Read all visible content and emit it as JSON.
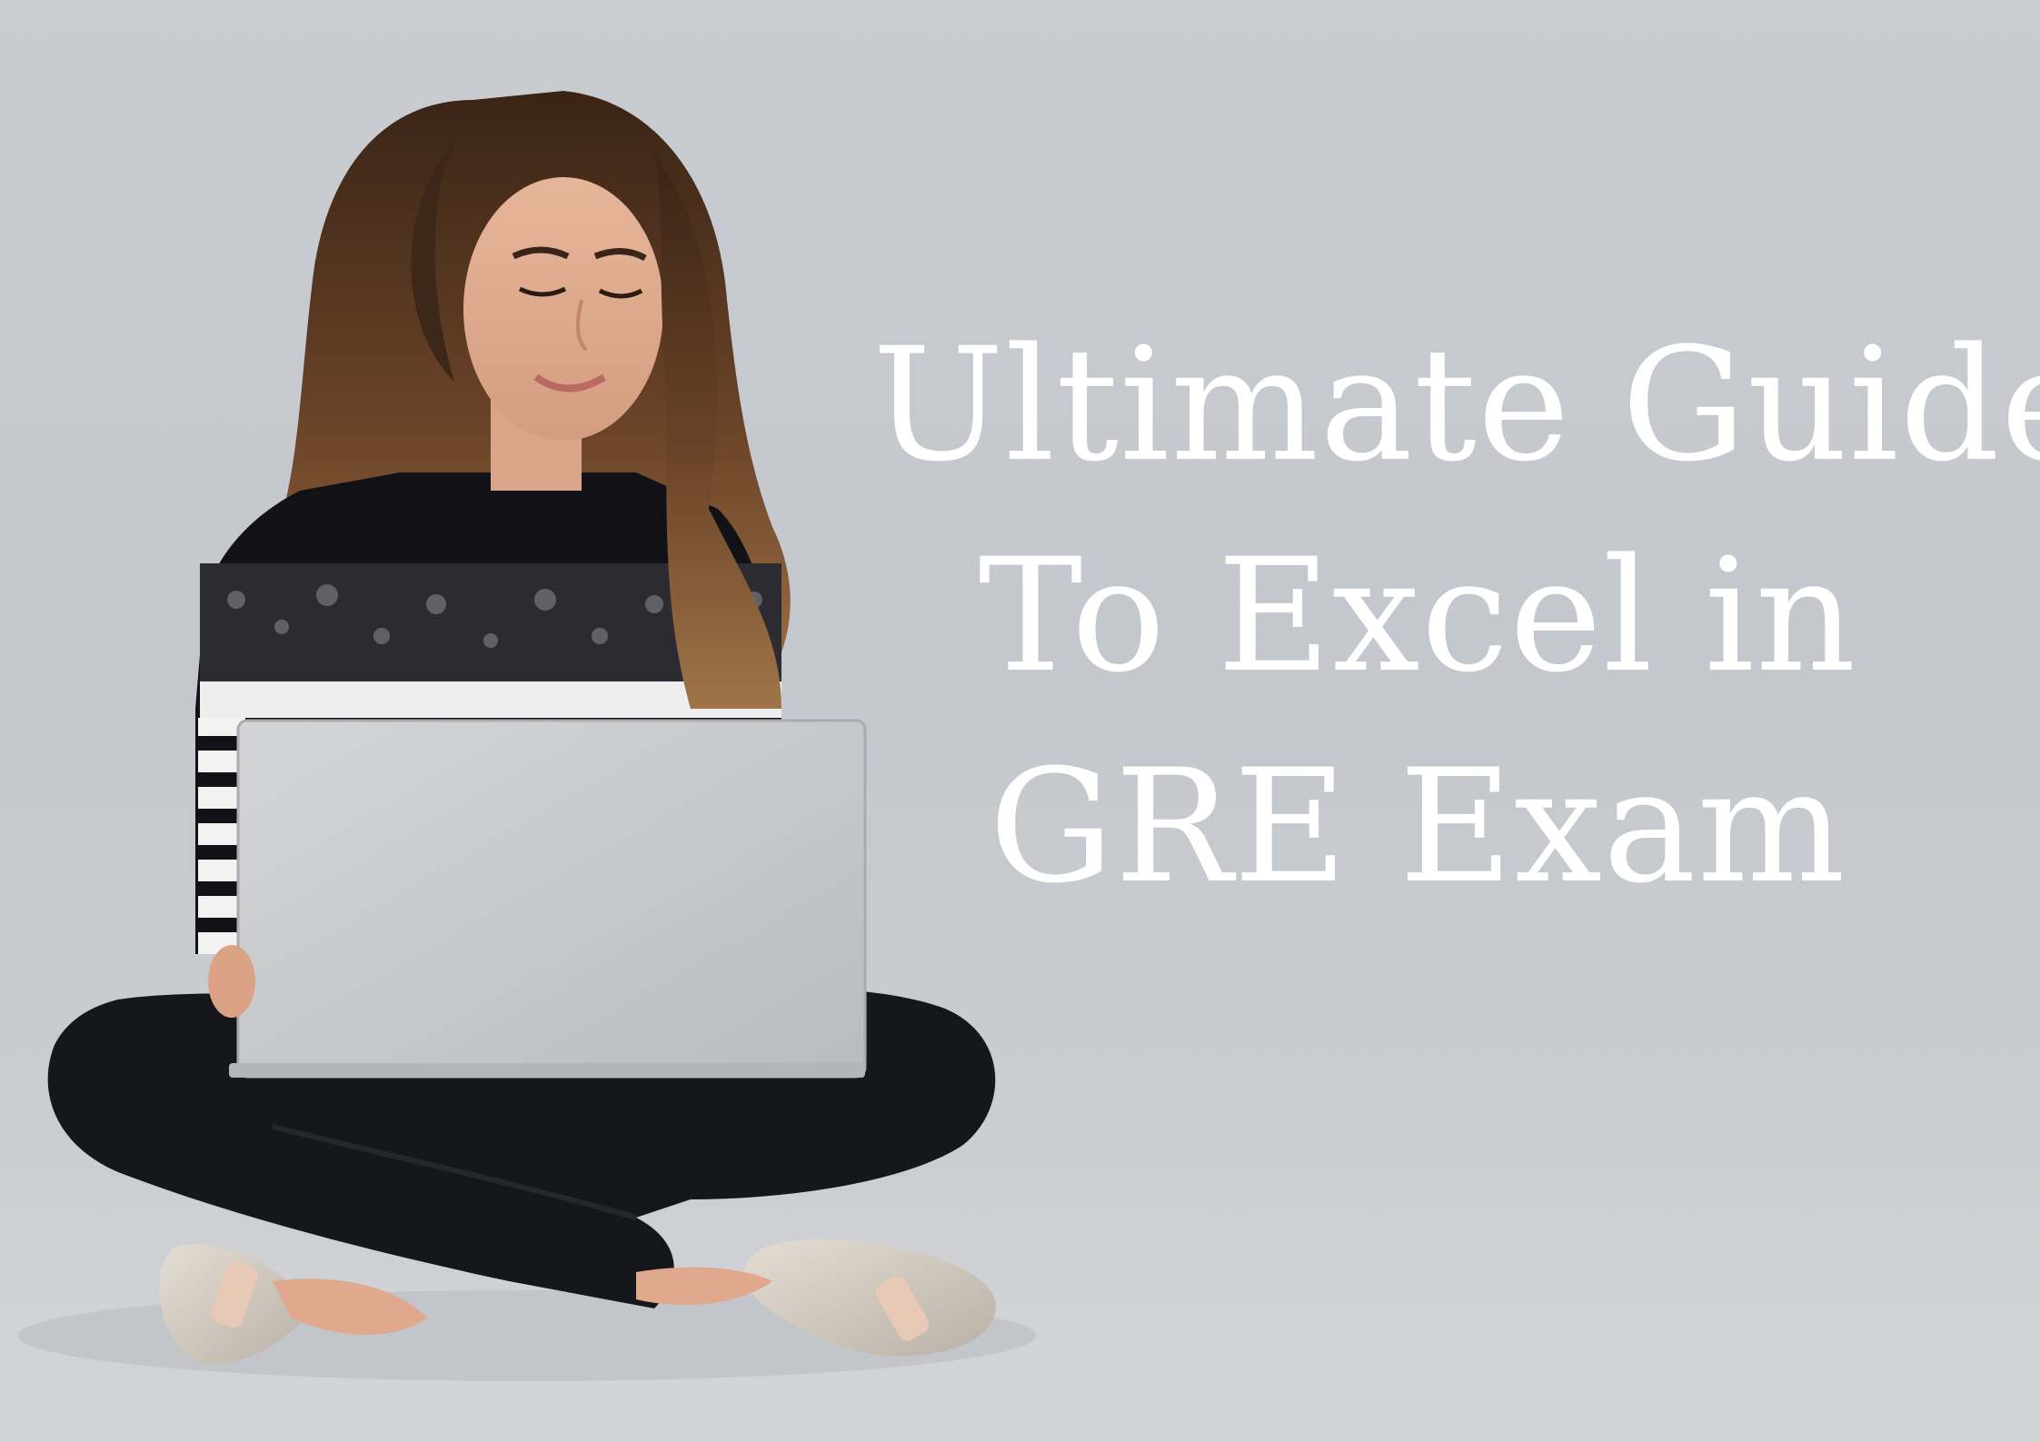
{
  "headline": {
    "line1": "Ultimate Guide",
    "line2": "To Excel in",
    "line3": "GRE Exam"
  },
  "colors": {
    "background": "#c6c9ce",
    "text": "#ffffff",
    "sweater": "#111114",
    "jeans": "#15171b",
    "laptop": "#c2c4c6",
    "hair": "#5a3a26"
  },
  "scene": {
    "subject": "woman sitting cross-legged using a laptop",
    "icons": [
      "laptop-icon"
    ]
  }
}
